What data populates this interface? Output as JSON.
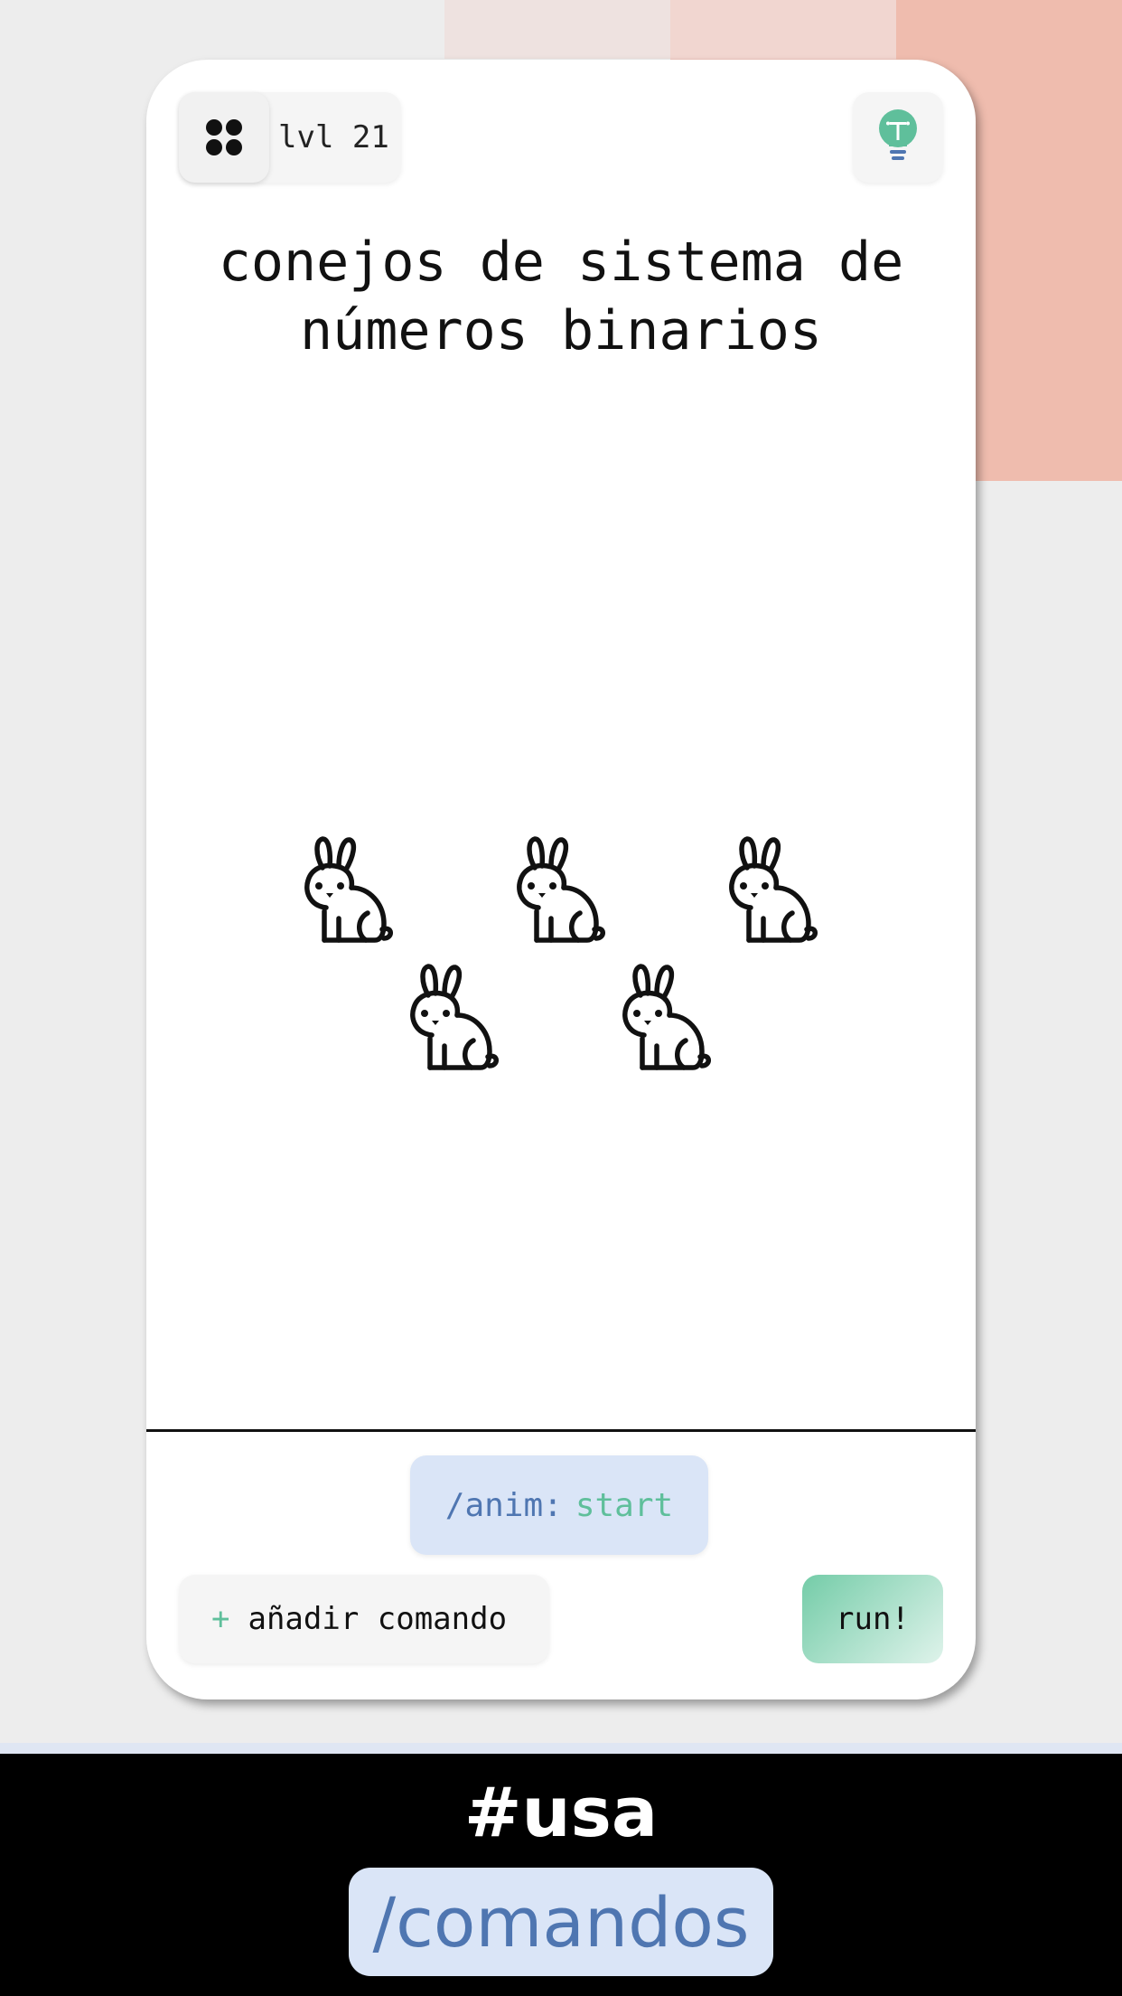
{
  "header": {
    "level_label": "lvl 21",
    "menu_icon": "grid-dots-icon",
    "hint_icon": "lightbulb-icon"
  },
  "puzzle": {
    "title": "conejos de sistema de números binarios",
    "rabbit_icon": "rabbit-icon",
    "rabbit_count": 5
  },
  "commands": {
    "active": {
      "name": "/anim:",
      "value": "start"
    },
    "add_label": "añadir comando",
    "add_symbol": "+",
    "run_label": "run!"
  },
  "footer": {
    "hashtag": "#usa",
    "highlight": "/comandos"
  },
  "colors": {
    "accent_green": "#5fbf9b",
    "accent_blue": "#4f76b1",
    "chip_bg": "#dae5f7",
    "background": "#ededed",
    "salmon": "#efbcae"
  }
}
